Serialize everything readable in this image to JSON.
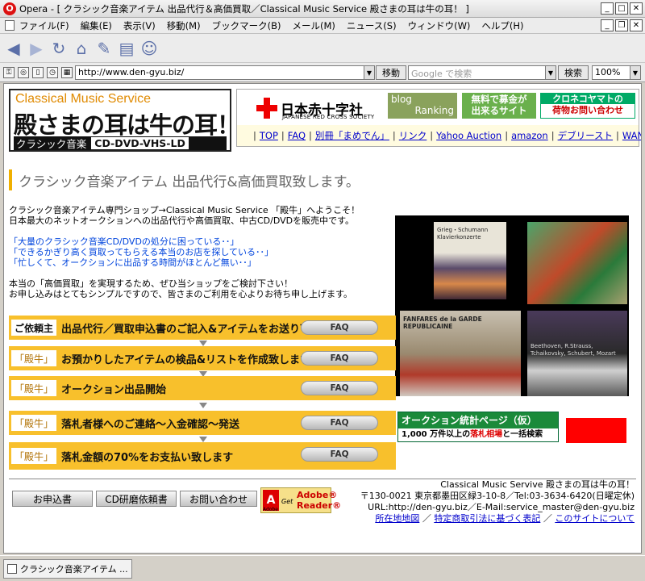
{
  "window": {
    "title": "Opera - [ クラシック音楽アイテム 出品代行＆高価買取／Classical Music Service 殿さまの耳は牛の耳！ ]"
  },
  "menu": [
    "ファイル(F)",
    "編集(E)",
    "表示(V)",
    "移動(M)",
    "ブックマーク(B)",
    "メール(M)",
    "ニュース(S)",
    "ウィンドウ(W)",
    "ヘルプ(H)"
  ],
  "address": {
    "url": "http://www.den-gyu.biz/",
    "go_label": "移動",
    "search_placeholder": "Google で検索",
    "search_label": "検索",
    "zoom": "100%"
  },
  "logo": {
    "top": "Classical Music Service",
    "main": "殿さまの耳は牛の耳！",
    "sub1": "クラシック音楽",
    "sub2": "CD-DVD-VHS-LD"
  },
  "banners": {
    "redcross": "日本赤十字社",
    "redcross_sub": "JAPANESE RED CROSS SOCIETY",
    "blog1": "blog",
    "blog2": "Ranking",
    "bokin1": "無料で募金が",
    "bokin2": "出来るサイト",
    "kuroneko1": "クロネコヤマトの",
    "kuroneko2": "荷物お問い合わせ"
  },
  "nav_links": [
    "TOP",
    "FAQ",
    "別冊「まめでん」",
    "リンク",
    "Yahoo Auction",
    "amazon",
    "デブリースト",
    "WANTED"
  ],
  "heading": "クラシック音楽アイテム 出品代行&高価買取致します。",
  "intro": {
    "p1_l1": "クラシック音楽アイテム専門ショップ→Classical Music Service 「殿牛」へようこそ！",
    "p1_l2": "日本最大のネットオークションへの出品代行や高価買取、中古CD/DVDを販売中です。",
    "q1": "「大量のクラシック音楽CD/DVDの処分に困っている･･」",
    "q2": "「できるかぎり高く買取ってもらえる本当のお店を探している･･」",
    "q3": "「忙しくて、オークションに出品する時間がほとんど無い･･」",
    "p3_l1": "本当の「高価買取」を実現するため、ぜひ当ショップをご検討下さい！",
    "p3_l2": "お申し込みはとてもシンプルですので、皆さまのご利用を心よりお待ち申し上げます。"
  },
  "photos": {
    "cd1_caption": "Grieg・Schumann\nKlavierkonzerte",
    "cd3_caption": "FANFARES de la GARDE\nREPUBLICAINE",
    "cd4_caption": "Beethoven, R.Strauss,\nTchaikovsky, Schubert, Mozart"
  },
  "steps": [
    {
      "tag": "ご依頼主",
      "text": "出品代行／買取申込書のご記入&アイテムをお送り下さい",
      "faq": "FAQ"
    },
    {
      "tag": "「殿牛」",
      "text": "お預かりしたアイテムの検品&リストを作成致します",
      "faq": "FAQ"
    },
    {
      "tag": "「殿牛」",
      "text": "オークション出品開始",
      "faq": "FAQ"
    },
    {
      "tag": "「殿牛」",
      "text": "落札者様へのご連絡～入金確認～発送",
      "faq": "FAQ"
    },
    {
      "tag": "「殿牛」",
      "text": "落札金額の70%をお支払い致します",
      "faq": "FAQ"
    }
  ],
  "auction_banner": {
    "title": "オークション統計ページ（仮）",
    "sub_pre": "1,000 万件以上の",
    "sub_red": "落札相場",
    "sub_post": "と一括検索"
  },
  "footer_buttons": [
    "お申込書",
    "CD研磨依頼書",
    "お問い合わせ"
  ],
  "adobe": {
    "get": "Get",
    "name1": "Adobe®",
    "name2": "Reader®",
    "brand": "Adobe"
  },
  "footer_info": {
    "name": "Classical Music Servive 殿さまの耳は牛の耳！",
    "addr": "〒130-0021 東京都墨田区緑3-10-8／Tel:03-3634-6420(日曜定休)",
    "url": "URL:http://den-gyu.biz／E-Mail:service_master@den-gyu.biz",
    "links": [
      "所在地地図",
      "特定商取引法に基づく表記",
      "このサイトについて"
    ]
  },
  "status_tab": "クラシック音楽アイテム ..."
}
